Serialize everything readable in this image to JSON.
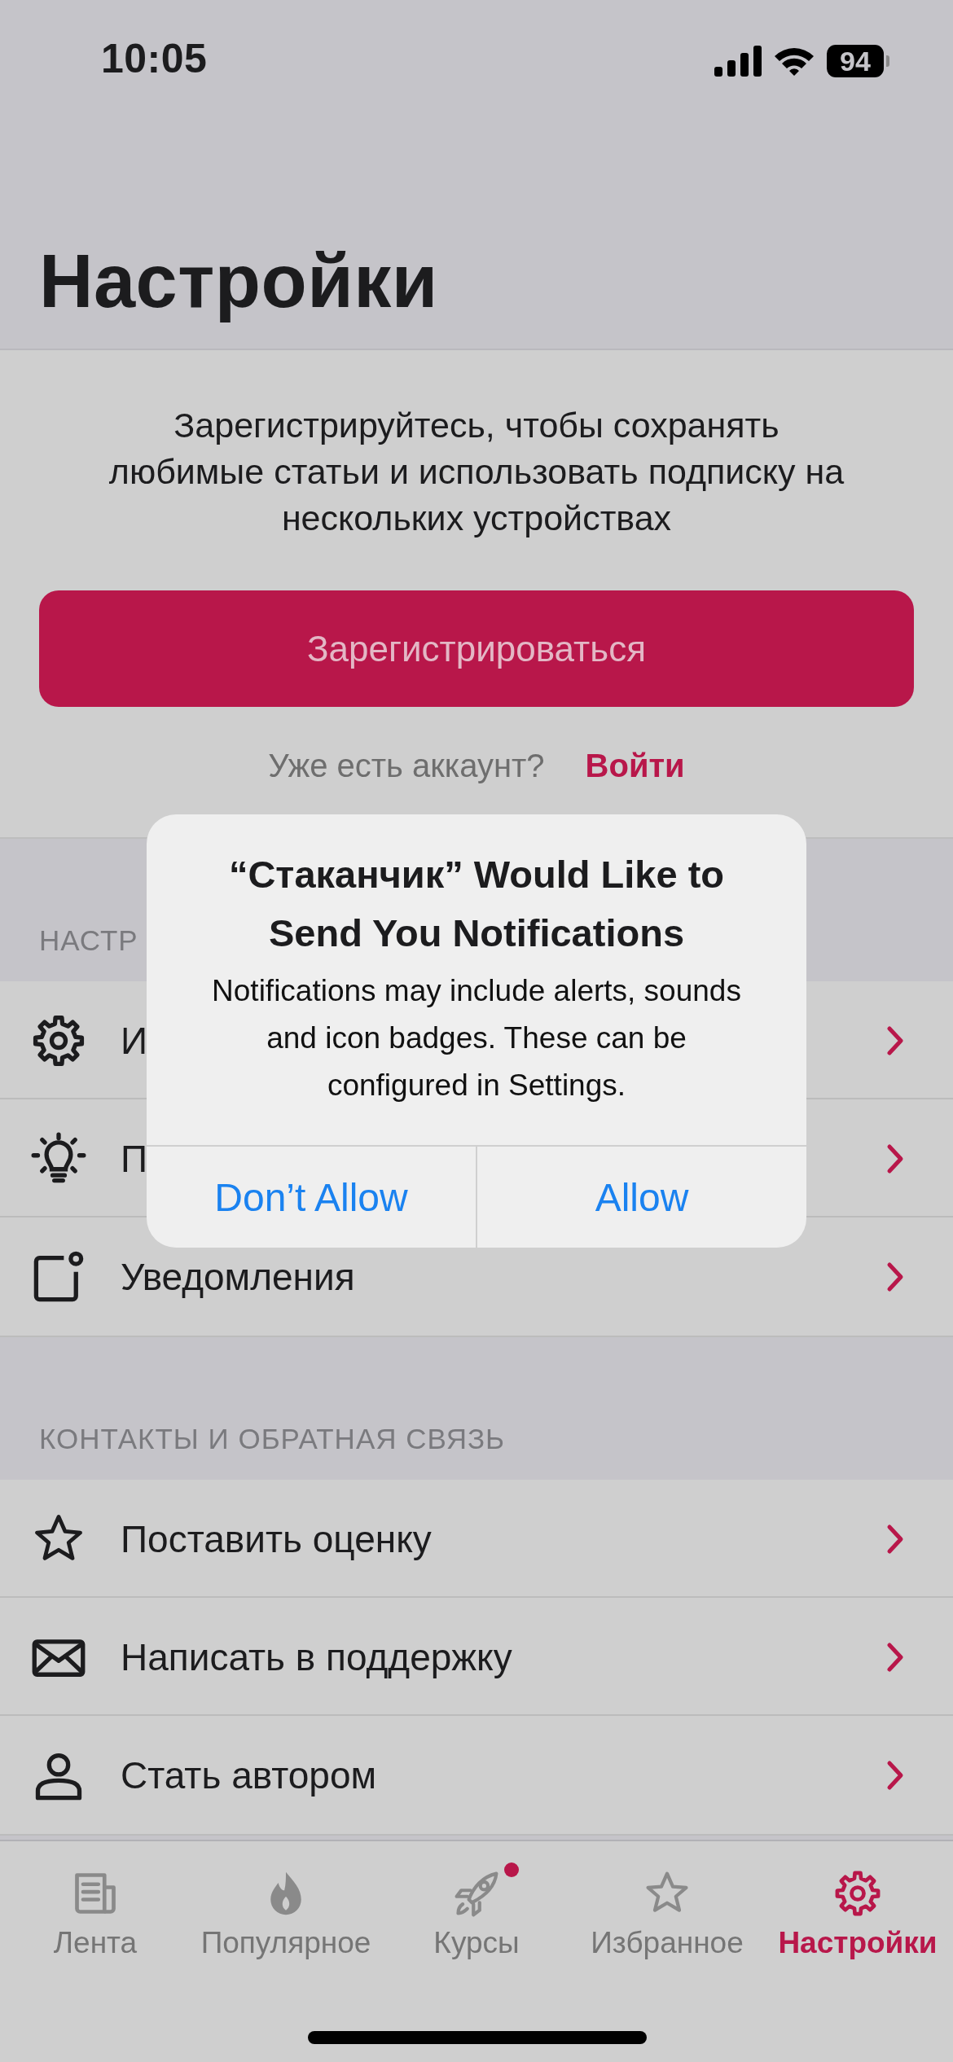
{
  "status_bar": {
    "time": "10:05",
    "battery": "94"
  },
  "title": "Настройки",
  "register": {
    "prompt": "Зарегистрируйтесь, чтобы сохранять любимые статьи и использовать подписку на нескольких устройствах",
    "button": "Зарегистрироваться",
    "have_account": "Уже есть аккаунт?",
    "login": "Войти"
  },
  "sections": [
    {
      "header": "НАСТР",
      "items": [
        {
          "kind": "gear",
          "label": "И"
        },
        {
          "kind": "bulb",
          "label": "П"
        },
        {
          "kind": "notification",
          "label": "Уведомления"
        }
      ]
    },
    {
      "header": "КОНТАКТЫ И ОБРАТНАЯ СВЯЗЬ",
      "items": [
        {
          "kind": "star",
          "label": "Поставить оценку"
        },
        {
          "kind": "mail",
          "label": "Написать в поддержку"
        },
        {
          "kind": "person",
          "label": "Стать автором"
        }
      ]
    }
  ],
  "alert": {
    "title": "“Стаканчик” Would Like to Send You Notifications",
    "message": "Notifications may include alerts, sounds and icon badges. These can be configured in Settings.",
    "buttons": [
      "Don’t Allow",
      "Allow"
    ]
  },
  "tabs": [
    {
      "kind": "news",
      "label": "Лента",
      "selected": false,
      "badge": false
    },
    {
      "kind": "flame",
      "label": "Популярное",
      "selected": false,
      "badge": false
    },
    {
      "kind": "rocket",
      "label": "Курсы",
      "selected": false,
      "badge": true
    },
    {
      "kind": "star",
      "label": "Избранное",
      "selected": false,
      "badge": false
    },
    {
      "kind": "gear",
      "label": "Настройки",
      "selected": true,
      "badge": false
    }
  ]
}
